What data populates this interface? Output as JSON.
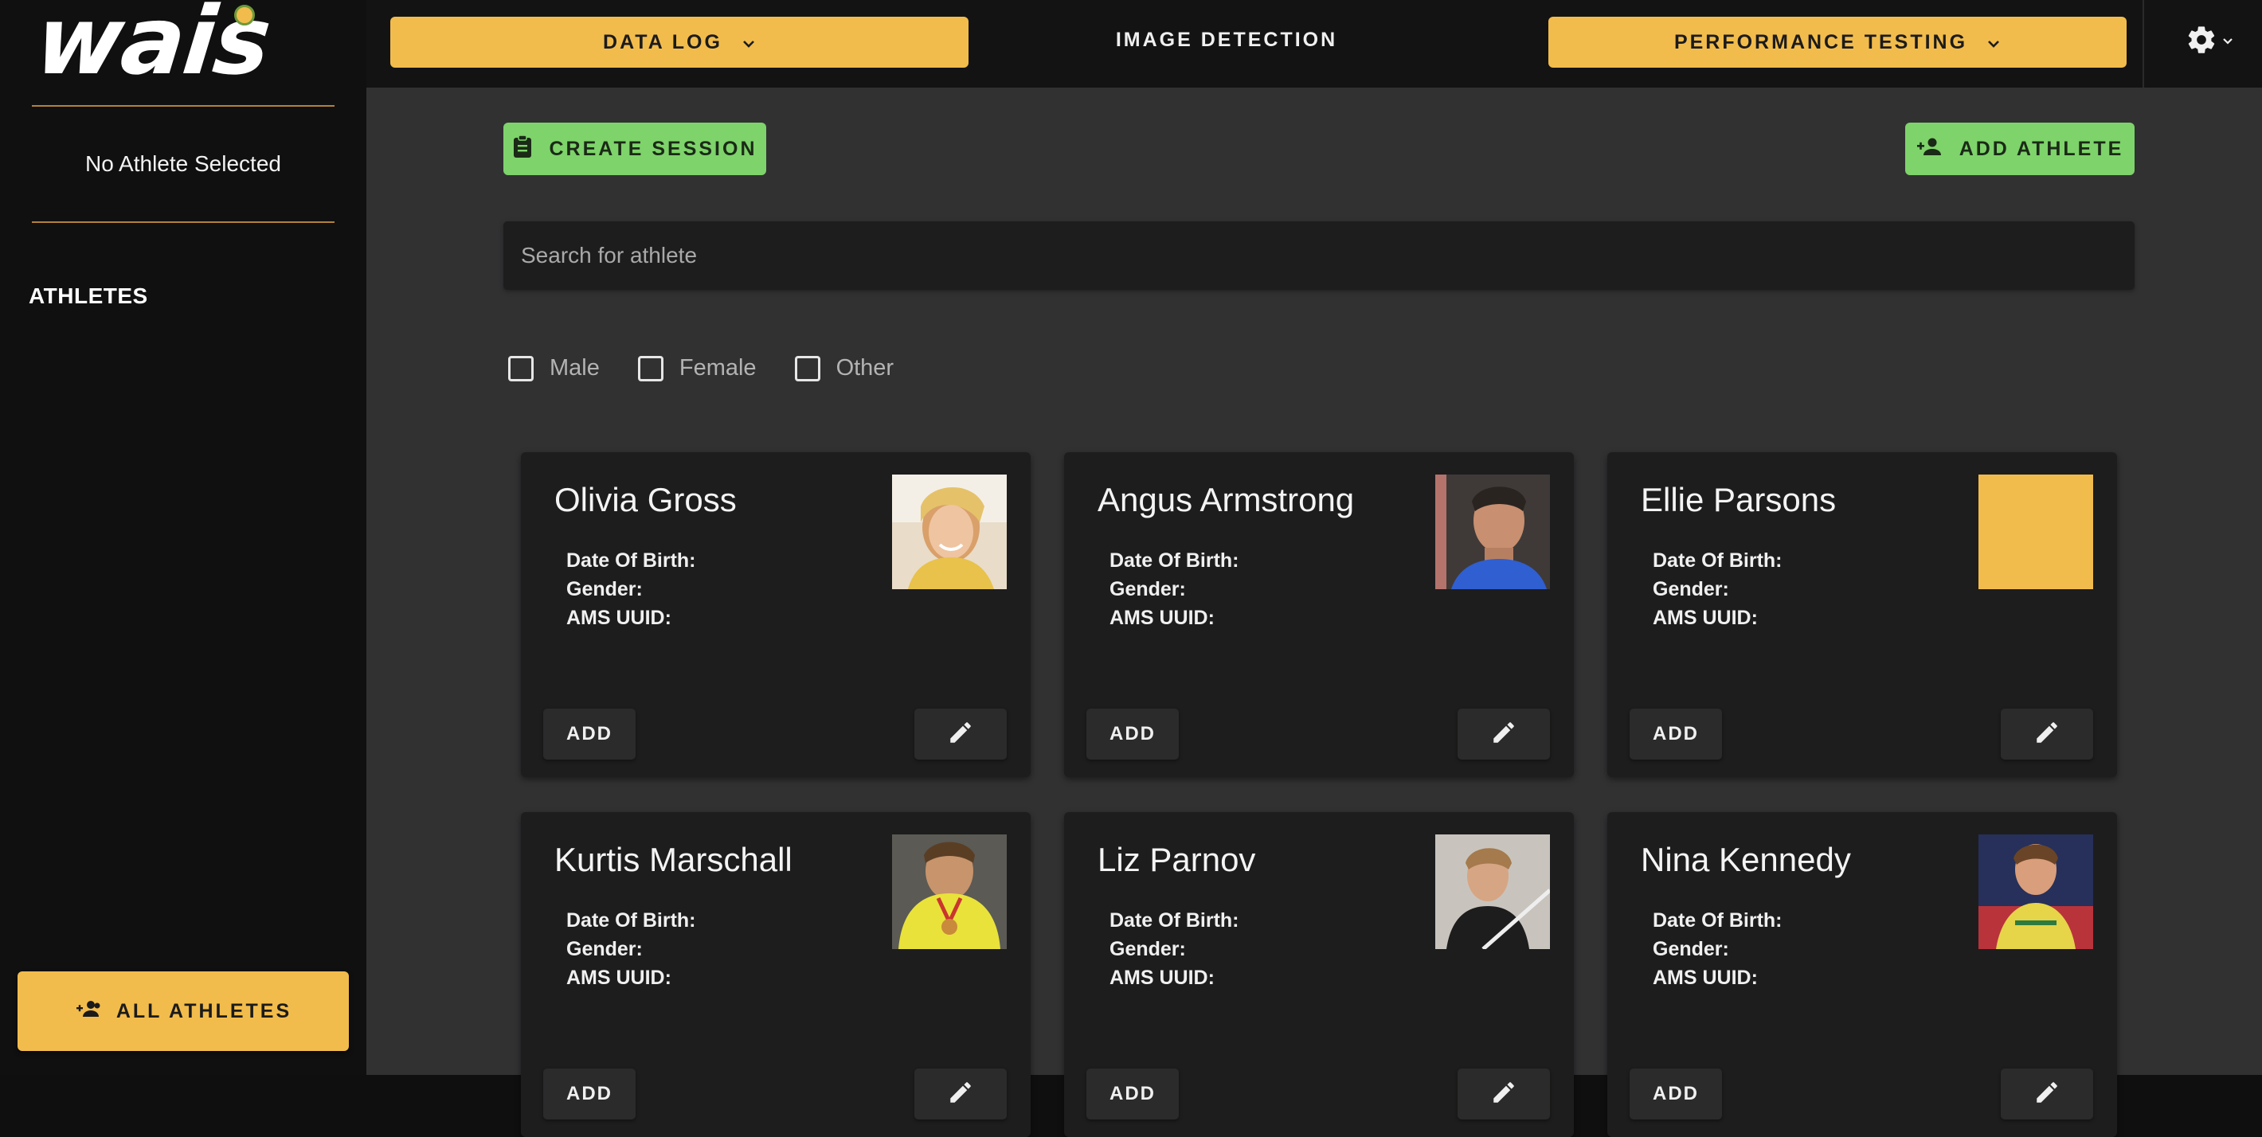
{
  "brand": {
    "logo_text": "wais",
    "accent": "#f2bc4c",
    "green": "#7ed36b"
  },
  "sidebar": {
    "status": "No Athlete Selected",
    "section_title": "ATHLETES",
    "all_athletes_label": "ALL ATHLETES"
  },
  "topnav": {
    "data_log_label": "DATA LOG",
    "image_detection_label": "IMAGE DETECTION",
    "performance_testing_label": "PERFORMANCE TESTING"
  },
  "actions": {
    "create_session_label": "CREATE SESSION",
    "add_athlete_label": "ADD ATHLETE"
  },
  "search": {
    "placeholder": "Search for athlete",
    "value": ""
  },
  "filters": [
    {
      "label": "Male",
      "checked": false
    },
    {
      "label": "Female",
      "checked": false
    },
    {
      "label": "Other",
      "checked": false
    }
  ],
  "field_labels": {
    "dob": "Date Of Birth:",
    "gender": "Gender:",
    "ams": "AMS UUID:"
  },
  "card_buttons": {
    "add_label": "ADD"
  },
  "athletes": [
    {
      "name": "Olivia Gross",
      "photo": "photo-blonde-athlete-yellow-top"
    },
    {
      "name": "Angus Armstrong",
      "photo": "photo-athlete-blue-shirt"
    },
    {
      "name": "Ellie Parsons",
      "photo": "placeholder-yellow-square"
    },
    {
      "name": "Kurtis Marschall",
      "photo": "photo-athlete-yellow-jersey-medal"
    },
    {
      "name": "Liz Parnov",
      "photo": "photo-athlete-pole-vault"
    },
    {
      "name": "Nina Kennedy",
      "photo": "photo-athlete-australia-flag"
    }
  ]
}
